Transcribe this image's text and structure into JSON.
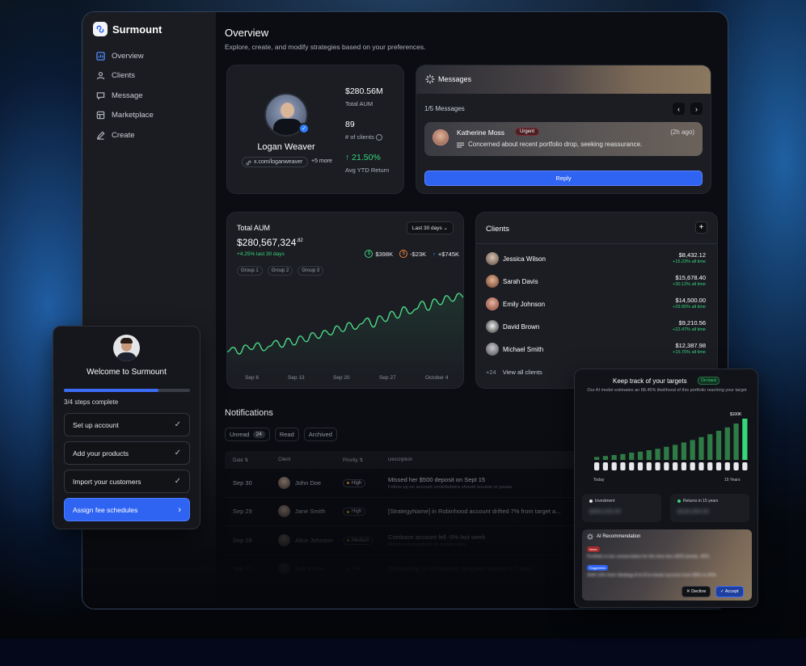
{
  "brand": {
    "name": "Surmount"
  },
  "sidebar": {
    "items": [
      {
        "label": "Overview",
        "icon": "overview-icon"
      },
      {
        "label": "Clients",
        "icon": "users-icon"
      },
      {
        "label": "Message",
        "icon": "message-icon"
      },
      {
        "label": "Marketplace",
        "icon": "store-icon"
      },
      {
        "label": "Create",
        "icon": "pen-icon"
      }
    ]
  },
  "header": {
    "title": "Overview",
    "subtitle": "Explore, create, and modify strategies based on your preferences."
  },
  "profile": {
    "name": "Logan Weaver",
    "link": "x.com/loganweaver",
    "more": "+5 more",
    "stats": [
      {
        "value": "$280.56M",
        "label": "Total AUM"
      },
      {
        "value": "89",
        "label": "# of clients"
      },
      {
        "value": "21.50%",
        "label": "Avg YTD Return"
      }
    ]
  },
  "messages": {
    "title": "Messages",
    "count": "1/5 Messages",
    "sender": "Katherine Moss",
    "badge": "Urgent",
    "time": "(2h ago)",
    "text": "Concerned about recent portfolio drop, seeking reassurance.",
    "reply_label": "Reply"
  },
  "aum": {
    "title": "Total AUM",
    "range": "Last 30 days",
    "value_main": "$280,567,324",
    "value_cents": ".82",
    "change": "+4.25% last 30 days",
    "metrics": [
      {
        "value": "$398K",
        "color": "#37d67a"
      },
      {
        "value": "-$23K",
        "color": "#e8813a"
      },
      {
        "value": "+$745K",
        "color": "#3b8bff"
      }
    ],
    "groups": [
      "Group 1",
      "Group 2",
      "Group 3"
    ],
    "x_labels": [
      "Sep 6",
      "Sep 13",
      "Sep 20",
      "Sep 27",
      "October 4"
    ]
  },
  "chart_data": {
    "type": "line",
    "title": "Total AUM",
    "x": [
      "Sep 6",
      "Sep 13",
      "Sep 20",
      "Sep 27",
      "October 4"
    ],
    "series": [
      {
        "values": [
          10,
          14,
          8,
          16,
          12,
          18,
          11,
          15,
          20,
          14,
          22,
          16,
          24,
          19,
          27,
          22,
          29,
          25,
          33,
          28,
          36,
          30,
          35,
          40,
          32,
          42,
          37,
          46,
          40,
          50,
          44,
          48,
          55,
          47,
          57,
          52,
          60,
          55,
          62,
          58
        ]
      }
    ]
  },
  "clients": {
    "title": "Clients",
    "rows": [
      {
        "name": "Jessica Wilson",
        "value": "$8,432.12",
        "change": "+15.23% all time"
      },
      {
        "name": "Sarah Davis",
        "value": "$15,678.40",
        "change": "+30.12% all time"
      },
      {
        "name": "Emily Johnson",
        "value": "$14,500.00",
        "change": "+29.95% all time"
      },
      {
        "name": "David Brown",
        "value": "$9,210.56",
        "change": "+22.47% all time"
      },
      {
        "name": "Michael Smith",
        "value": "$12,387.98",
        "change": "+15.75% all time"
      }
    ],
    "more_count": "+24",
    "view_all": "View all clients"
  },
  "notifications": {
    "title": "Notifications",
    "tabs": [
      {
        "label": "Unread",
        "count": "24"
      },
      {
        "label": "Read",
        "count": ""
      },
      {
        "label": "Archived",
        "count": ""
      }
    ],
    "headers": {
      "date": "Date",
      "client": "Client",
      "priority": "Priority",
      "description": "Description"
    },
    "rows": [
      {
        "date": "Sep 30",
        "client": "John Doe",
        "priority": "High",
        "desc": "Missed her $500 deposit on Sept 15",
        "sub": "Follow up on account contributions should resume or pause."
      },
      {
        "date": "Sep 29",
        "client": "Jane Smith",
        "priority": "High",
        "desc": "[StrategyName] in Robinhood account drifted 7% from target a...",
        "sub": ""
      },
      {
        "date": "Sep 28",
        "client": "Alice Johnson",
        "priority": "Medium",
        "desc": "Coinbase account fell -5% last week",
        "sub": "Reach out proactively to ensure calm."
      },
      {
        "date": "Sep 27",
        "client": "Bob Brown",
        "priority": "Low",
        "desc": "Onboarding is not finished, progress expires in 7 days",
        "sub": ""
      }
    ]
  },
  "welcome": {
    "title": "Welcome to Surmount",
    "progress": 0.75,
    "steps_label": "3/4 steps complete",
    "steps": [
      {
        "label": "Set up account"
      },
      {
        "label": "Add your products"
      },
      {
        "label": "Import your customers"
      },
      {
        "label": "Assign fee schedules"
      }
    ]
  },
  "targets": {
    "title": "Keep track of your targets",
    "badge": "On-track",
    "subtitle": "Our AI model estimates an 88.45% likelihood of this portfolio reaching your target",
    "peak_label": "$100K",
    "x_start": "Today",
    "x_end": "15 Years",
    "bars": [
      0.06,
      0.08,
      0.1,
      0.12,
      0.15,
      0.17,
      0.2,
      0.23,
      0.27,
      0.31,
      0.36,
      0.41,
      0.47,
      0.53,
      0.6,
      0.67,
      0.75,
      0.85
    ],
    "boxes": [
      {
        "label": "Investment",
        "value": "$450,025.00",
        "color": "#e5e6e9"
      },
      {
        "label": "Returns in 15 years",
        "value": "$100,000.00",
        "color": "#37d67a"
      }
    ],
    "recommendation": {
      "title": "AI Recommendation",
      "issue_tag": "Issue",
      "issue_text": "Portfolio is too conservative for the time line (60% bonds, 40%",
      "suggestion_tag": "Suggestion",
      "suggestion_text": "Shift 15% from Strategy A to B to boost success from 88% to 95%",
      "decline_label": "Decline",
      "accept_label": "Accept"
    }
  }
}
